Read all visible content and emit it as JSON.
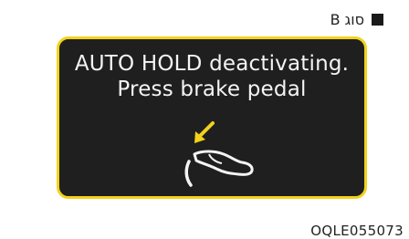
{
  "header": {
    "type_label": "B סוג"
  },
  "display": {
    "message_line_1": "AUTO HOLD deactivating.",
    "message_line_2": "Press brake pedal",
    "border_color": "#f2d21b",
    "background_color": "#1f1f1f",
    "icon": "foot-pressing-brake-pedal-icon",
    "arrow_color": "#f2d21b"
  },
  "footer": {
    "figure_code": "OQLE055073"
  }
}
